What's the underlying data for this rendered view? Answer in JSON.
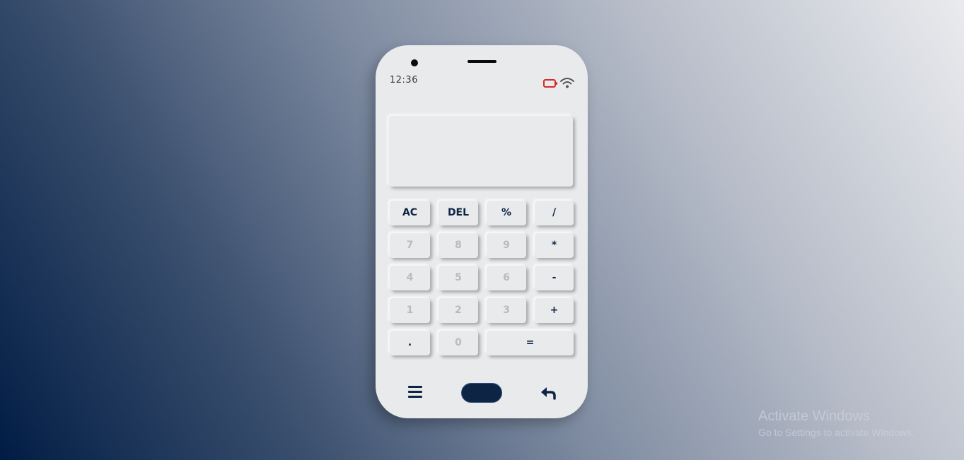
{
  "status_bar": {
    "time": "12:36",
    "battery_icon": "battery-low-icon",
    "wifi_icon": "wifi-icon",
    "battery_color": "#d62a2a"
  },
  "display": {
    "value": ""
  },
  "keypad": {
    "ac": "AC",
    "del": "DEL",
    "percent": "%",
    "divide": "/",
    "seven": "7",
    "eight": "8",
    "nine": "9",
    "multiply": "*",
    "four": "4",
    "five": "5",
    "six": "6",
    "minus": "-",
    "one": "1",
    "two": "2",
    "three": "3",
    "plus": "+",
    "decimal": ".",
    "zero": "0",
    "equals": "="
  },
  "nav_bar": {
    "menu_icon": "hamburger-menu-icon",
    "home_icon": "home-pill",
    "back_icon": "reply-arrow-icon"
  },
  "colors": {
    "phone_body": "#e8eaec",
    "operator_text": "#0e2444",
    "number_text": "#b9bbbf",
    "home_pill": "#0e2444"
  },
  "watermark": {
    "title": "Activate Windows",
    "subtitle": "Go to Settings to activate Windows."
  }
}
